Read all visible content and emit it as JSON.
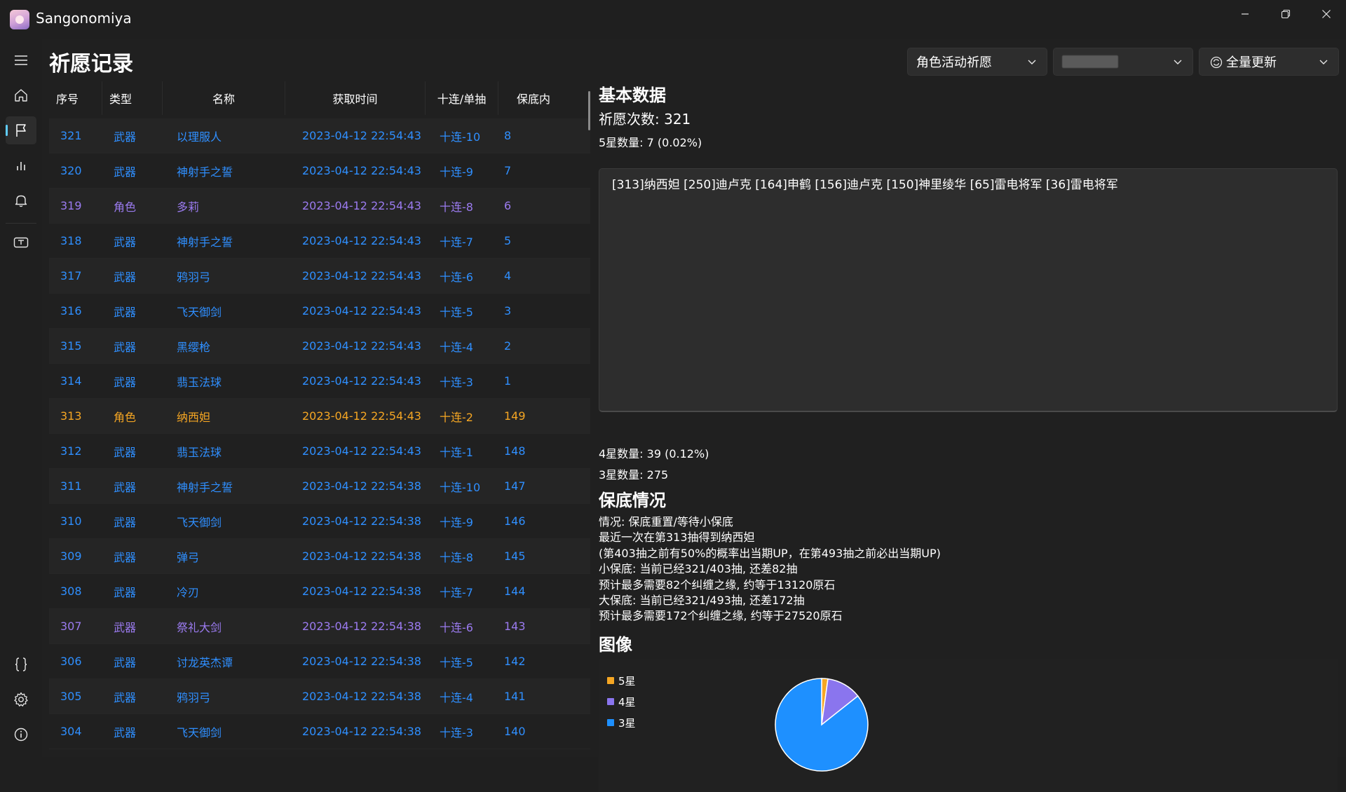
{
  "app": {
    "title": "Sangonomiya"
  },
  "page": {
    "title": "祈愿记录"
  },
  "toolbar": {
    "wish_type": "角色活动祈愿",
    "update_label": "全量更新"
  },
  "table": {
    "columns": [
      "序号",
      "类型",
      "名称",
      "获取时间",
      "十连/单抽",
      "保底内"
    ],
    "rows": [
      {
        "idx": "321",
        "type": "武器",
        "name": "以理服人",
        "time": "2023-04-12 22:54:43",
        "ten": "十连-10",
        "pity": "8",
        "rarity": "3"
      },
      {
        "idx": "320",
        "type": "武器",
        "name": "神射手之誓",
        "time": "2023-04-12 22:54:43",
        "ten": "十连-9",
        "pity": "7",
        "rarity": "3"
      },
      {
        "idx": "319",
        "type": "角色",
        "name": "多莉",
        "time": "2023-04-12 22:54:43",
        "ten": "十连-8",
        "pity": "6",
        "rarity": "4"
      },
      {
        "idx": "318",
        "type": "武器",
        "name": "神射手之誓",
        "time": "2023-04-12 22:54:43",
        "ten": "十连-7",
        "pity": "5",
        "rarity": "3"
      },
      {
        "idx": "317",
        "type": "武器",
        "name": "鸦羽弓",
        "time": "2023-04-12 22:54:43",
        "ten": "十连-6",
        "pity": "4",
        "rarity": "3"
      },
      {
        "idx": "316",
        "type": "武器",
        "name": "飞天御剑",
        "time": "2023-04-12 22:54:43",
        "ten": "十连-5",
        "pity": "3",
        "rarity": "3"
      },
      {
        "idx": "315",
        "type": "武器",
        "name": "黑缨枪",
        "time": "2023-04-12 22:54:43",
        "ten": "十连-4",
        "pity": "2",
        "rarity": "3"
      },
      {
        "idx": "314",
        "type": "武器",
        "name": "翡玉法球",
        "time": "2023-04-12 22:54:43",
        "ten": "十连-3",
        "pity": "1",
        "rarity": "3"
      },
      {
        "idx": "313",
        "type": "角色",
        "name": "纳西妲",
        "time": "2023-04-12 22:54:43",
        "ten": "十连-2",
        "pity": "149",
        "rarity": "5"
      },
      {
        "idx": "312",
        "type": "武器",
        "name": "翡玉法球",
        "time": "2023-04-12 22:54:43",
        "ten": "十连-1",
        "pity": "148",
        "rarity": "3"
      },
      {
        "idx": "311",
        "type": "武器",
        "name": "神射手之誓",
        "time": "2023-04-12 22:54:38",
        "ten": "十连-10",
        "pity": "147",
        "rarity": "3"
      },
      {
        "idx": "310",
        "type": "武器",
        "name": "飞天御剑",
        "time": "2023-04-12 22:54:38",
        "ten": "十连-9",
        "pity": "146",
        "rarity": "3"
      },
      {
        "idx": "309",
        "type": "武器",
        "name": "弹弓",
        "time": "2023-04-12 22:54:38",
        "ten": "十连-8",
        "pity": "145",
        "rarity": "3"
      },
      {
        "idx": "308",
        "type": "武器",
        "name": "冷刃",
        "time": "2023-04-12 22:54:38",
        "ten": "十连-7",
        "pity": "144",
        "rarity": "3"
      },
      {
        "idx": "307",
        "type": "武器",
        "name": "祭礼大剑",
        "time": "2023-04-12 22:54:38",
        "ten": "十连-6",
        "pity": "143",
        "rarity": "4"
      },
      {
        "idx": "306",
        "type": "武器",
        "name": "讨龙英杰谭",
        "time": "2023-04-12 22:54:38",
        "ten": "十连-5",
        "pity": "142",
        "rarity": "3"
      },
      {
        "idx": "305",
        "type": "武器",
        "name": "鸦羽弓",
        "time": "2023-04-12 22:54:38",
        "ten": "十连-4",
        "pity": "141",
        "rarity": "3"
      },
      {
        "idx": "304",
        "type": "武器",
        "name": "飞天御剑",
        "time": "2023-04-12 22:54:38",
        "ten": "十连-3",
        "pity": "140",
        "rarity": "3"
      }
    ]
  },
  "colors": {
    "accent": "#60cdff",
    "rarity_5": "#f5a623",
    "rarity_4": "#9b7bf0",
    "rarity_3": "#2f8fff"
  },
  "basic": {
    "heading": "基本数据",
    "total": "祈愿次数: 321",
    "five_star": "5星数量: 7 (0.02%)",
    "five_star_list": "[313]纳西妲 [250]迪卢克 [164]申鹤 [156]迪卢克 [150]神里绫华 [65]雷电将军 [36]雷电将军",
    "four_star": "4星数量: 39 (0.12%)",
    "three_star": "3星数量: 275"
  },
  "pity": {
    "heading": "保底情况",
    "lines": [
      "情况: 保底重置/等待小保底",
      "最近一次在第313抽得到纳西妲",
      "(第403抽之前有50%的概率出当期UP，在第493抽之前必出当期UP)",
      "小保底: 当前已经321/403抽, 还差82抽",
      "预计最多需要82个纠缠之缘, 约等于13120原石",
      "大保底: 当前已经321/493抽, 还差172抽",
      "预计最多需要172个纠缠之缘, 约等于27520原石"
    ]
  },
  "chart_section": {
    "heading": "图像"
  },
  "chart_data": {
    "type": "pie",
    "categories": [
      "5星",
      "4星",
      "3星"
    ],
    "values": [
      7,
      39,
      275
    ],
    "colors": [
      "#f5a623",
      "#8a75ee",
      "#1e90ff"
    ],
    "legend": "top-left"
  }
}
